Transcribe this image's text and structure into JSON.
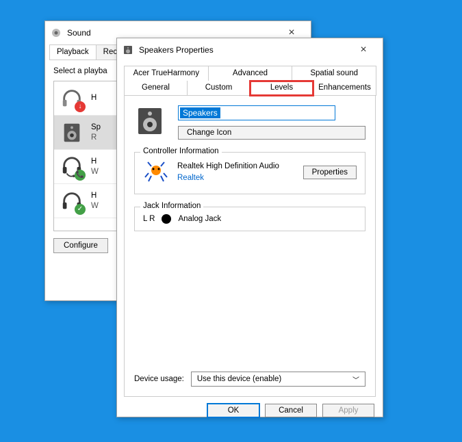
{
  "soundWindow": {
    "title": "Sound",
    "tabs": {
      "playback": "Playback",
      "recording": "Recor"
    },
    "instruction": "Select a playba",
    "devices": [
      {
        "line1": "H",
        "line2": "",
        "kind": "headphones",
        "badge": "red"
      },
      {
        "line1": "Sp",
        "line2": "R",
        "kind": "speaker",
        "badge": "",
        "selected": true
      },
      {
        "line1": "H",
        "line2": "W",
        "kind": "headset",
        "badge": "green"
      },
      {
        "line1": "H",
        "line2": "W",
        "kind": "headphones",
        "badge": "green"
      }
    ],
    "configure": "Configure"
  },
  "propsWindow": {
    "title": "Speakers Properties",
    "tabsTop": {
      "acer": "Acer TrueHarmony",
      "advanced": "Advanced",
      "spatial": "Spatial sound"
    },
    "tabsBottom": {
      "general": "General",
      "custom": "Custom",
      "levels": "Levels",
      "enhancements": "Enhancements"
    },
    "nameValue": "Speakers",
    "changeIcon": "Change Icon",
    "controller": {
      "legend": "Controller Information",
      "name": "Realtek High Definition Audio",
      "vendor": "Realtek",
      "propertiesBtn": "Properties"
    },
    "jack": {
      "legend": "Jack Information",
      "lr": "L R",
      "label": "Analog Jack"
    },
    "usage": {
      "label": "Device usage:",
      "selected": "Use this device (enable)"
    },
    "footer": {
      "ok": "OK",
      "cancel": "Cancel",
      "apply": "Apply"
    }
  }
}
